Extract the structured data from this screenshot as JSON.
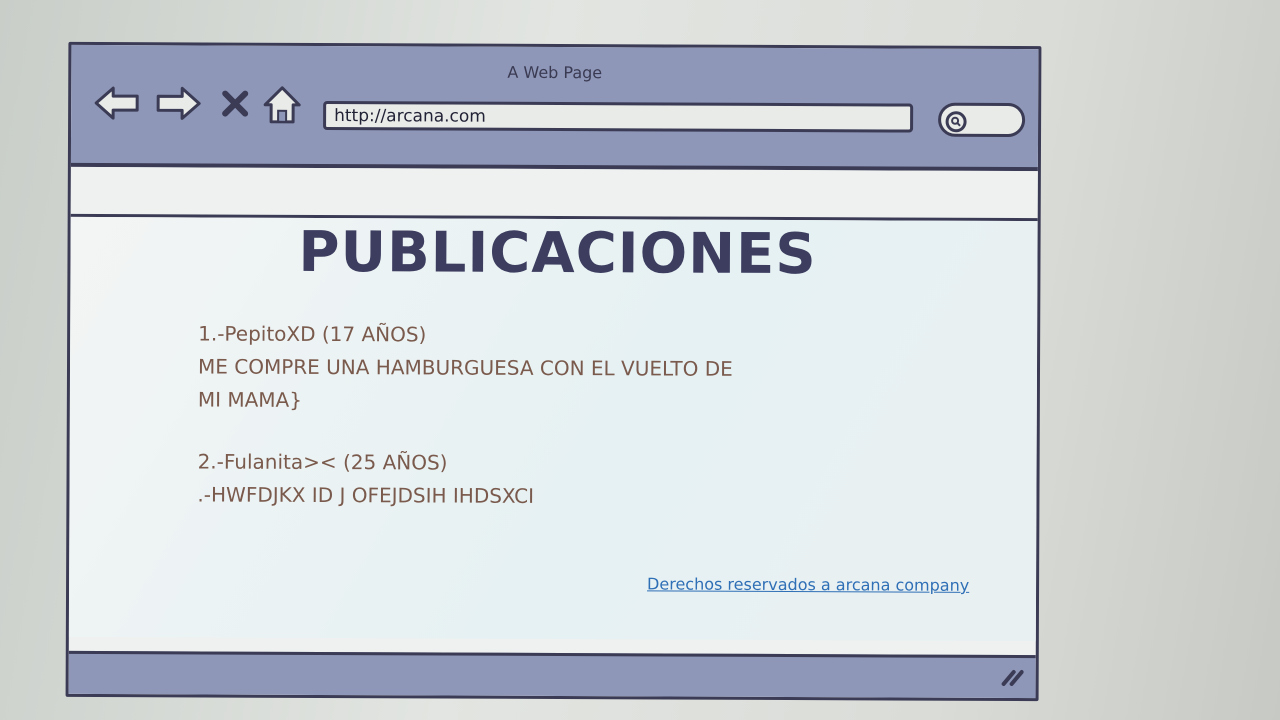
{
  "window": {
    "title": "A Web Page"
  },
  "toolbar": {
    "back_icon": "left-arrow-icon",
    "forward_icon": "right-arrow-icon",
    "stop_icon": "close-x-icon",
    "home_icon": "home-icon",
    "search_icon": "magnifier-icon"
  },
  "address_bar": {
    "url": "http://arcana.com"
  },
  "page": {
    "heading": "PUBLICACIONES",
    "posts": [
      {
        "author_line": "1.-PepitoXD (17 AÑOS)",
        "body_lines": [
          "ME COMPRE UNA HAMBURGUESA CON EL VUELTO DE",
          "MI MAMA}"
        ]
      },
      {
        "author_line": "2.-Fulanita>< (25 AÑOS)",
        "body_lines": [
          ".-HWFDJKX ID J OFEJDSIH IHDSXCI"
        ]
      }
    ],
    "footer_link": "Derechos reservados a arcana company"
  },
  "colors": {
    "chrome": "#8e97b8",
    "outline": "#3b3b55",
    "heading": "#3c3d5f",
    "post_text": "#7a5a4c",
    "link": "#2f6fb6"
  }
}
